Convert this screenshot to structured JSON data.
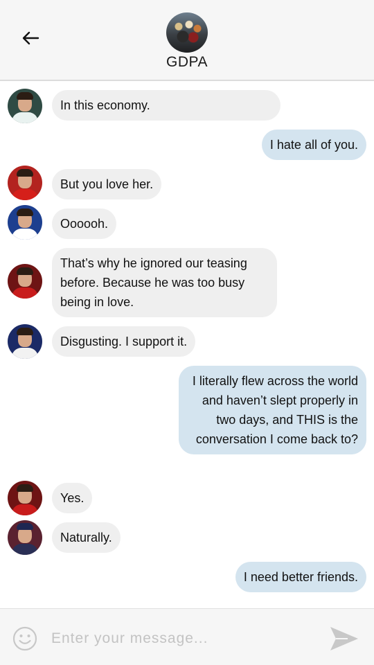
{
  "header": {
    "title": "GDPA",
    "back_icon": "arrow-left-icon",
    "avatar_icon": "group-photo-avatar"
  },
  "messages": [
    {
      "direction": "in",
      "text": "In this economy."
    },
    {
      "direction": "out",
      "text": "I hate all of you."
    },
    {
      "direction": "in",
      "text": "But you love her."
    },
    {
      "direction": "in",
      "text": "Oooooh."
    },
    {
      "direction": "in",
      "text": "That’s why he ignored our teasing before. Because he was too busy being in love."
    },
    {
      "direction": "in",
      "text": "Disgusting. I support it."
    },
    {
      "direction": "out",
      "text": "I literally flew across the world and haven’t slept properly in two days, and THIS is the conversation I come back to?"
    },
    {
      "direction": "in",
      "text": "Yes."
    },
    {
      "direction": "in",
      "text": "Naturally."
    },
    {
      "direction": "out",
      "text": "I need better friends."
    }
  ],
  "composer": {
    "placeholder": "Enter your message...",
    "value": "",
    "emoji_icon": "smiley-icon",
    "send_icon": "send-icon"
  },
  "colors": {
    "header_bg": "#f6f6f6",
    "incoming_bubble": "#efefef",
    "outgoing_bubble": "#d4e4ef",
    "icon_gray": "#c8c8c8"
  }
}
